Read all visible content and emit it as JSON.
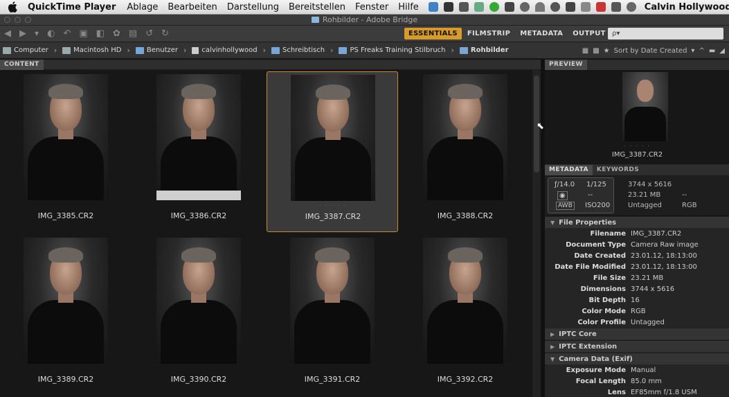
{
  "menubar": {
    "app_name": "QuickTime Player",
    "items": [
      "Ablage",
      "Bearbeiten",
      "Darstellung",
      "Bereitstellen",
      "Fenster",
      "Hilfe"
    ],
    "user": "Calvin Hollywood"
  },
  "window": {
    "title": "Rohbilder - Adobe Bridge"
  },
  "toolbar": {
    "workspaces": [
      "ESSENTIALS",
      "FILMSTRIP",
      "METADATA",
      "OUTPUT"
    ],
    "active_workspace": "ESSENTIALS",
    "search_placeholder": "ρ▾"
  },
  "path": {
    "crumbs": [
      "Computer",
      "Macintosh HD",
      "Benutzer",
      "calvinhollywood",
      "Schreibtisch",
      "PS Freaks Training Stilbruch",
      "Rohbilder"
    ],
    "sort_label": "Sort by Date Created"
  },
  "content": {
    "tab": "CONTENT",
    "items": [
      {
        "name": "IMG_3385.CR2"
      },
      {
        "name": "IMG_3386.CR2"
      },
      {
        "name": "IMG_3387.CR2",
        "selected": true
      },
      {
        "name": "IMG_3388.CR2"
      },
      {
        "name": "IMG_3389.CR2"
      },
      {
        "name": "IMG_3390.CR2"
      },
      {
        "name": "IMG_3391.CR2"
      },
      {
        "name": "IMG_3392.CR2"
      }
    ],
    "selected_dots": "· · · · ·"
  },
  "preview": {
    "tab": "PREVIEW",
    "filename": "IMG_3387.CR2",
    "dots": "· · · · ·"
  },
  "metadata": {
    "tabs": [
      "METADATA",
      "KEYWORDS"
    ],
    "camera": {
      "aperture": "ƒ/14.0",
      "shutter": "1/125",
      "metering": "--",
      "wb": "AWB",
      "iso": "ISO200",
      "dimensions": "3744 x 5616",
      "size": "23.21 MB",
      "dash": "--",
      "profile": "Untagged",
      "mode": "RGB"
    },
    "sections": {
      "file_properties": "File Properties",
      "iptc_core": "IPTC Core",
      "iptc_extension": "IPTC Extension",
      "camera_data": "Camera Data (Exif)"
    },
    "file_properties": [
      {
        "k": "Filename",
        "v": "IMG_3387.CR2"
      },
      {
        "k": "Document Type",
        "v": "Camera Raw image"
      },
      {
        "k": "Date Created",
        "v": "23.01.12, 18:13:00"
      },
      {
        "k": "Date File Modified",
        "v": "23.01.12, 18:13:00"
      },
      {
        "k": "File Size",
        "v": "23.21 MB"
      },
      {
        "k": "Dimensions",
        "v": "3744 x 5616"
      },
      {
        "k": "Bit Depth",
        "v": "16"
      },
      {
        "k": "Color Mode",
        "v": "RGB"
      },
      {
        "k": "Color Profile",
        "v": "Untagged"
      }
    ],
    "camera_data": [
      {
        "k": "Exposure Mode",
        "v": "Manual"
      },
      {
        "k": "Focal Length",
        "v": "85.0 mm"
      },
      {
        "k": "Lens",
        "v": "EF85mm f/1.8 USM"
      }
    ]
  },
  "colors": {
    "accent": "#d89a2a",
    "panel": "#252525",
    "content_bg": "#171717"
  }
}
